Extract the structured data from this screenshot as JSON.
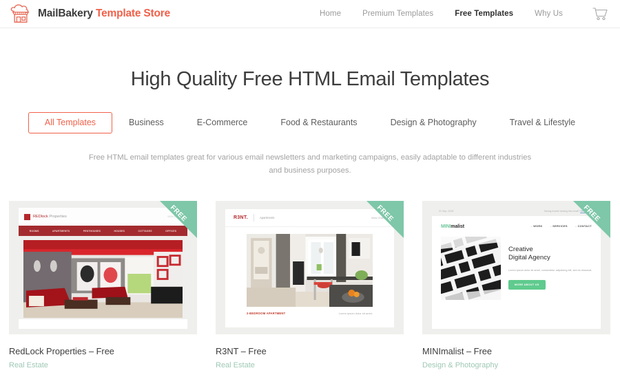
{
  "header": {
    "brand_primary": "MailBakery",
    "brand_secondary": "Template Store",
    "logo_icon": "bakery-shop-icon",
    "cart_icon": "shopping-cart-icon",
    "nav": [
      {
        "label": "Home",
        "active": false
      },
      {
        "label": "Premium Templates",
        "active": false
      },
      {
        "label": "Free Templates",
        "active": true
      },
      {
        "label": "Why Us",
        "active": false
      }
    ]
  },
  "hero": {
    "title": "High Quality Free HTML Email Templates",
    "description": "Free HTML email templates great for various email newsletters and marketing campaigns, easily adaptable to different industries and business purposes."
  },
  "filters": [
    {
      "label": "All Templates",
      "active": true
    },
    {
      "label": "Business",
      "active": false
    },
    {
      "label": "E-Commerce",
      "active": false
    },
    {
      "label": "Food & Restaurants",
      "active": false
    },
    {
      "label": "Design & Photography",
      "active": false
    },
    {
      "label": "Travel & Lifestyle",
      "active": false
    }
  ],
  "badge": {
    "label": "FREE"
  },
  "colors": {
    "accent": "#f0614a",
    "badge_green": "#7ec7a8",
    "category_green": "#9fc8b6",
    "title_gray": "#3d3d3d",
    "muted_gray": "#a3a3a3"
  },
  "cards": [
    {
      "title": "RedLock Properties – Free",
      "category": "Real Estate",
      "badge": "FREE",
      "preview": {
        "brand": "REDlock",
        "brand_suffix": " Properties",
        "date": "VIEW ONLINE",
        "nav": [
          "ROOMS",
          "APARTMENTS",
          "PENTHOUSES",
          "HOUSES",
          "COTTAGES",
          "OFFICES"
        ]
      }
    },
    {
      "title": "R3NT – Free",
      "category": "Real Estate",
      "badge": "FREE",
      "preview": {
        "brand": "R3NT.",
        "subtitle": "Apartments",
        "view_online": "View Online",
        "caption_left": "2-BEDROOM APARTMENT",
        "caption_right": "Lorem ipsum dolor sit amet."
      }
    },
    {
      "title": "MINImalist – Free",
      "category": "Design & Photography",
      "badge": "FREE",
      "preview": {
        "date": "21 Sep, 2016",
        "preheader": "Having trouble viewing this email?",
        "preheader_link": "View it online",
        "brand_accent": "MINI",
        "brand_rest": "malist",
        "nav": [
          "WORK",
          "SERVICES",
          "CONTACT"
        ],
        "heading_line1": "Creative",
        "heading_line2": "Digital Agency",
        "paragraph": "Lorem ipsum dolor sit amet, consectetur adipiscing elit, sed do eiusmod.",
        "button": "MORE ABOUT US"
      }
    }
  ]
}
